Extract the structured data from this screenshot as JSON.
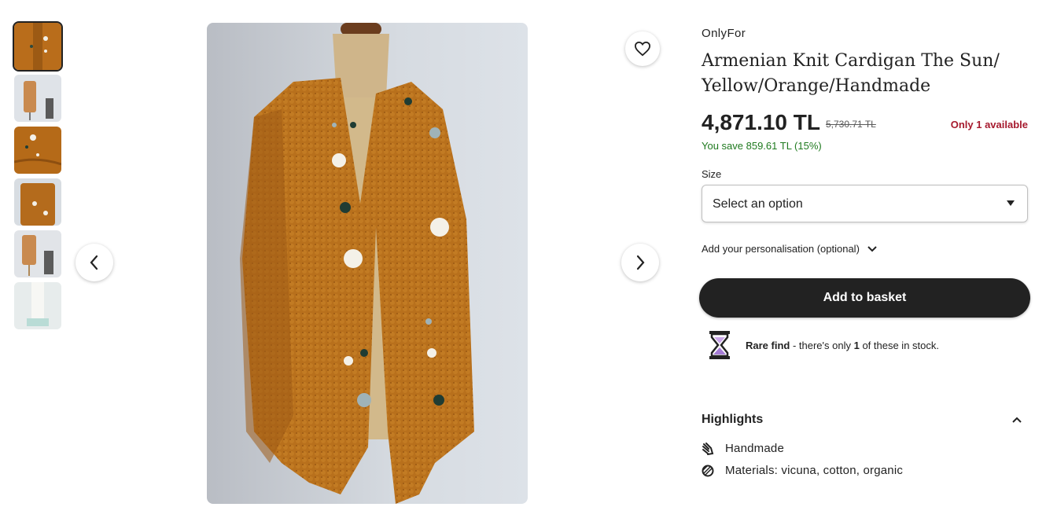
{
  "gallery": {
    "thumbnail_count": 6,
    "active_index": 0,
    "colors": {
      "cardigan": "#b86f1a",
      "background": "#cfd4db",
      "active_border": "#222222"
    }
  },
  "shop": {
    "name": "OnlyFor"
  },
  "product": {
    "title": "Armenian Knit Cardigan The Sun/ Yellow/Orange/Handmade",
    "price": "4,871.10 TL",
    "original_price": "5,730.71 TL",
    "availability": "Only 1 available",
    "savings": "You save 859.61 TL (15%)"
  },
  "options": {
    "size_label": "Size",
    "size_placeholder": "Select an option",
    "personalisation_label": "Add your personalisation (optional)"
  },
  "actions": {
    "add_to_basket": "Add to basket"
  },
  "stock_notice": {
    "bold": "Rare find",
    "text_before_count": " - there's only ",
    "count": "1",
    "text_after_count": " of these in stock."
  },
  "highlights": {
    "heading": "Highlights",
    "items": [
      {
        "icon": "hand-icon",
        "label": "Handmade"
      },
      {
        "icon": "yarn-icon",
        "label": "Materials: vicuna, cotton, organic"
      }
    ]
  },
  "colors": {
    "primary_button": "#222222",
    "availability": "#a61a2e",
    "savings": "#1f7a1f"
  }
}
